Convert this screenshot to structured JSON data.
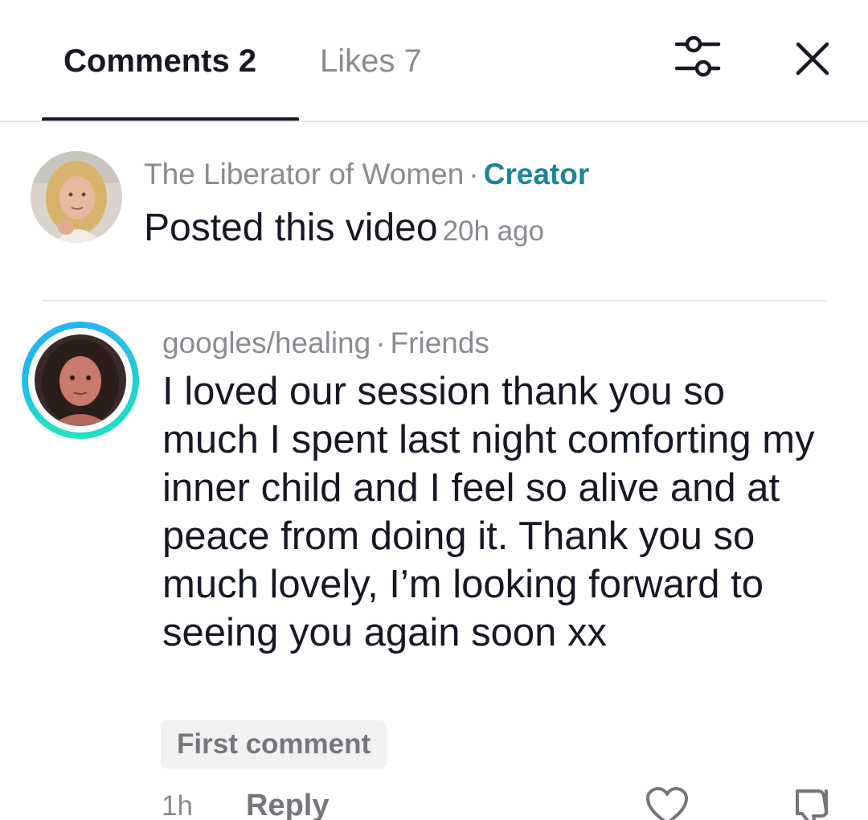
{
  "tabs": [
    {
      "label": "Comments 2",
      "active": true
    },
    {
      "label": "Likes 7",
      "active": false
    }
  ],
  "icons": {
    "filter": "sliders-icon",
    "close": "close-icon",
    "like": "heart-icon",
    "dislike": "thumbs-down-icon"
  },
  "creator_post": {
    "name": "The Liberator of Women",
    "separator": "·",
    "badge": "Creator",
    "text": "Posted this video",
    "time": "20h ago"
  },
  "comment": {
    "username": "googles/healing",
    "separator": "·",
    "relation": "Friends",
    "text": "I loved our session thank you so much I spent last night comforting my inner child and I feel so alive and at peace from doing it. Thank you so much lovely, I’m looking forward to seeing you again soon xx",
    "badge": "First comment",
    "time": "1h",
    "reply_label": "Reply"
  },
  "colors": {
    "creator_badge": "#1d8596",
    "muted_text": "#8a8b91",
    "primary_text": "#161823",
    "avatar_ring_start": "#22e3c3",
    "avatar_ring_end": "#1fb6f0"
  }
}
